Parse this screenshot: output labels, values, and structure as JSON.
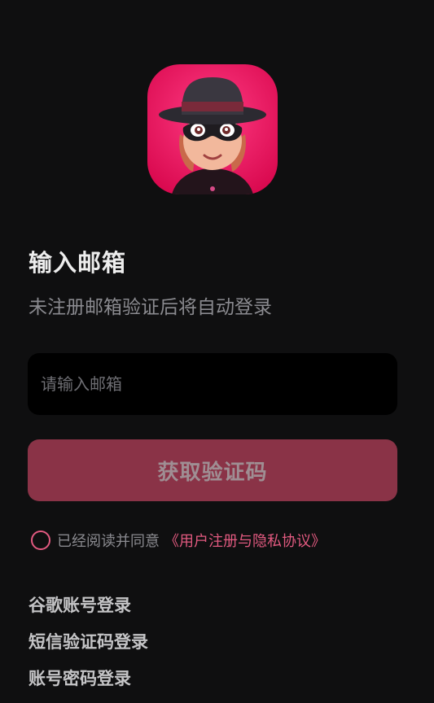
{
  "header": {
    "app_icon": "masked-character-icon"
  },
  "form": {
    "title": "输入邮箱",
    "subtitle": "未注册邮箱验证后将自动登录",
    "email_placeholder": "请输入邮箱",
    "email_value": "",
    "submit_label": "获取验证码"
  },
  "agreement": {
    "checked": false,
    "text": "已经阅读并同意",
    "link_label": "《用户注册与隐私协议》"
  },
  "alt_logins": [
    {
      "label": "谷歌账号登录"
    },
    {
      "label": "短信验证码登录"
    },
    {
      "label": "账号密码登录"
    }
  ],
  "colors": {
    "background": "#0f0f10",
    "accent": "#e25a80",
    "button_disabled": "#8a3347",
    "input_background": "#000000"
  }
}
